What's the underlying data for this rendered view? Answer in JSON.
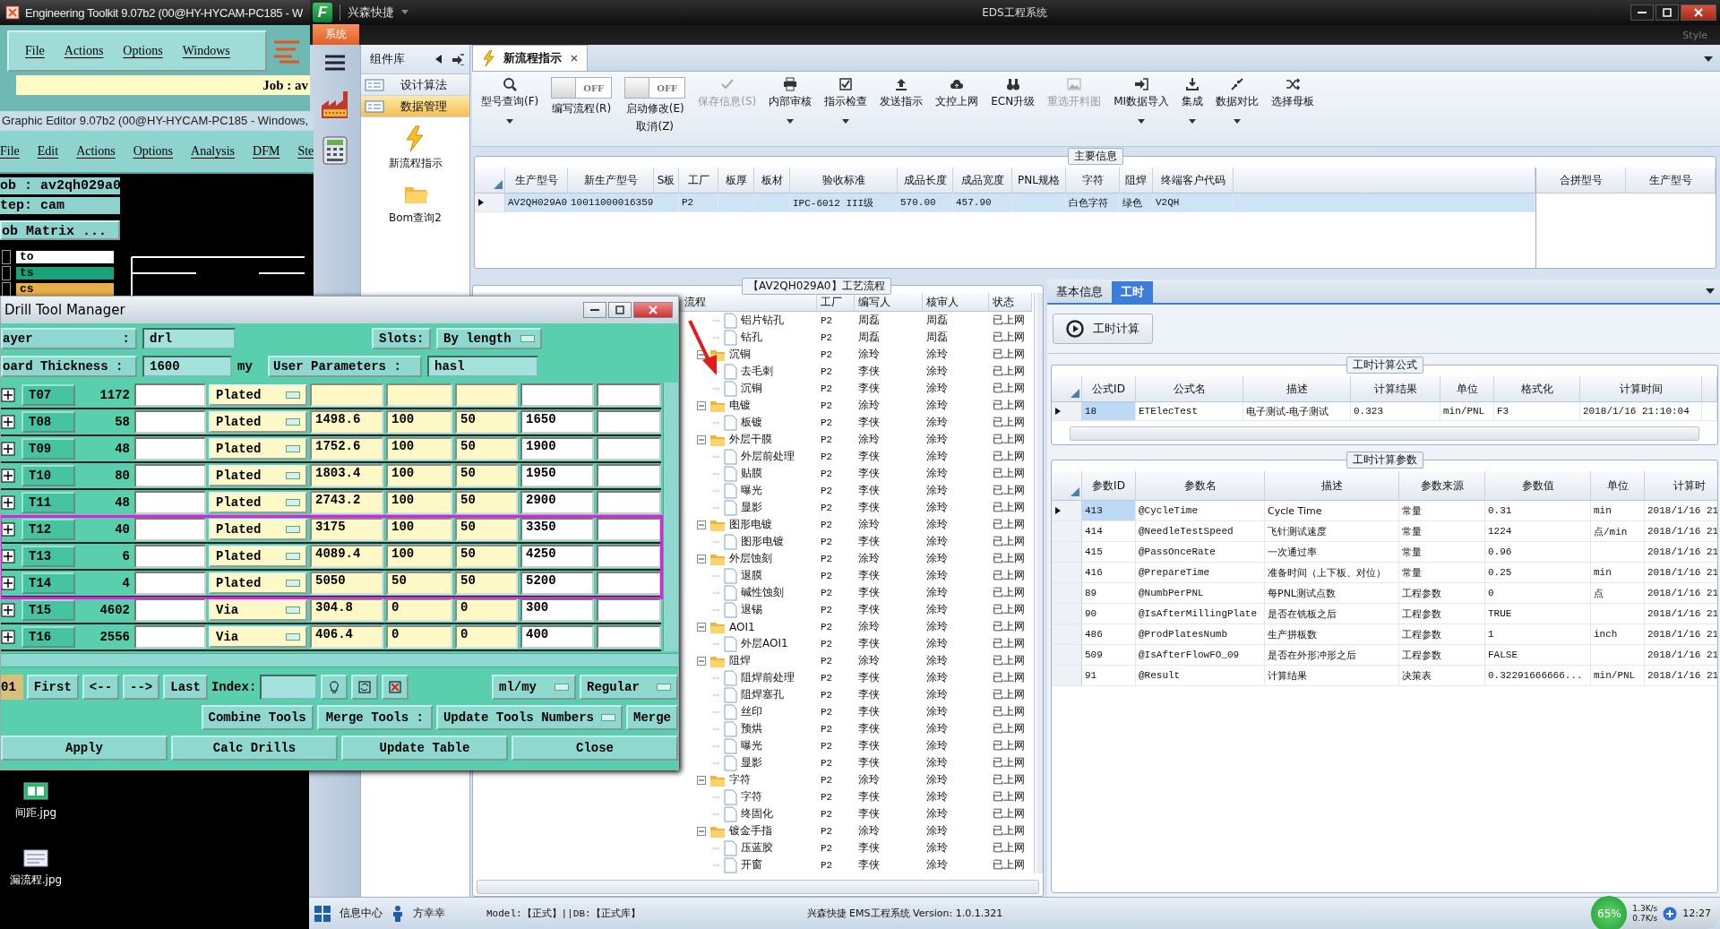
{
  "toolkit_window": {
    "title": "Engineering Toolkit 9.07b2 (00@HY-HYCAM-PC185 - W",
    "menu": [
      "File",
      "Actions",
      "Options",
      "Windows"
    ],
    "job": "Job : av"
  },
  "graphic_editor": {
    "title": "Graphic Editor 9.07b2 (00@HY-HYCAM-PC185 - Windows,",
    "menu": [
      "File",
      "Edit",
      "Actions",
      "Options",
      "Analysis",
      "DFM",
      "Ste"
    ],
    "job": "ob : av2qh029a0",
    "step": "tep: cam",
    "matrix_button": "ob Matrix ...",
    "layers": [
      {
        "name": "to",
        "color": "#ffffff",
        "checked": false
      },
      {
        "name": "ts",
        "color": "#1aa37a",
        "checked": false
      },
      {
        "name": "cs",
        "color": "#e8b04a",
        "checked": false
      }
    ]
  },
  "drill": {
    "title": "Drill Tool Manager",
    "layer_label": "ayer",
    "layer_sep": ":",
    "layer": "drl",
    "slots_label": "Slots:",
    "slots": "By length",
    "thickness_label": "oard Thickness :",
    "thickness": "1600",
    "thickness_unit": "my",
    "user_params_label": "User Parameters :",
    "user_params": "hasl",
    "rows": [
      {
        "tool": "T07",
        "count": "1172",
        "type": "Plated",
        "marked": false
      },
      {
        "tool": "T08",
        "count": "58",
        "type": "Plated",
        "value_1": "1498.6",
        "value_2": "100",
        "value_3": "50",
        "value_4": "1650",
        "marked": false
      },
      {
        "tool": "T09",
        "count": "48",
        "type": "Plated",
        "value_1": "1752.6",
        "value_2": "100",
        "value_3": "50",
        "value_4": "1900",
        "marked": false
      },
      {
        "tool": "T10",
        "count": "80",
        "type": "Plated",
        "value_1": "1803.4",
        "value_2": "100",
        "value_3": "50",
        "value_4": "1950",
        "marked": false
      },
      {
        "tool": "T11",
        "count": "48",
        "type": "Plated",
        "value_1": "2743.2",
        "value_2": "100",
        "value_3": "50",
        "value_4": "2900",
        "marked": false
      },
      {
        "tool": "T12",
        "count": "40",
        "type": "Plated",
        "value_1": "3175",
        "value_2": "100",
        "value_3": "50",
        "value_4": "3350",
        "marked": true
      },
      {
        "tool": "T13",
        "count": "6",
        "type": "Plated",
        "value_1": "4089.4",
        "value_2": "100",
        "value_3": "50",
        "value_4": "4250",
        "marked": true
      },
      {
        "tool": "T14",
        "count": "4",
        "type": "Plated",
        "value_1": "5050",
        "value_2": "50",
        "value_3": "50",
        "value_4": "5200",
        "marked": true
      },
      {
        "tool": "T15",
        "count": "4602",
        "type": "Via",
        "value_1": "304.8",
        "value_2": "0",
        "value_3": "0",
        "value_4": "300",
        "marked": false
      },
      {
        "tool": "T16",
        "count": "2556",
        "type": "Via",
        "value_1": "406.4",
        "value_2": "0",
        "value_3": "0",
        "value_4": "400",
        "marked": false
      }
    ],
    "current": "01",
    "nav": [
      "First",
      "<--",
      "-->",
      "Last"
    ],
    "index_label": "Index:",
    "units": "ml/my",
    "mode": "Regular",
    "combine": "Combine Tools",
    "merge_label": "Merge Tools :",
    "merge_option": "Update Tools Numbers",
    "merge": "Merge",
    "actions": [
      "Apply",
      "Calc Drills",
      "Update Table",
      "Close"
    ]
  },
  "eds": {
    "logo": "F",
    "app_name": "兴森快捷",
    "title": "EDS工程系统",
    "system_tab": "系统",
    "style_label": "Style",
    "component_panel": {
      "title": "组件库",
      "items": [
        {
          "label": "设计算法",
          "selected": false
        },
        {
          "label": "数据管理",
          "selected": true
        }
      ],
      "tiles": [
        {
          "label": "新流程指示"
        },
        {
          "label": "Bom查询2"
        }
      ]
    },
    "doc_tab": {
      "label": "新流程指示"
    },
    "toolbar": [
      {
        "kind": "button",
        "label": "型号查询(F)",
        "dropdown": true,
        "disabled": false
      },
      {
        "kind": "toggle",
        "label": "编写流程(R)",
        "switch_text": "OFF",
        "on": false
      },
      {
        "kind": "toggle",
        "label": "启动修改(E)",
        "second_line": "取消(Z)",
        "switch_text": "OFF",
        "on": false
      },
      {
        "kind": "button",
        "label": "保存信息(S)",
        "dropdown": false,
        "disabled": true
      },
      {
        "kind": "button",
        "label": "内部审核",
        "dropdown": true,
        "disabled": false
      },
      {
        "kind": "button",
        "label": "指示检查",
        "dropdown": true,
        "disabled": false
      },
      {
        "kind": "button",
        "label": "发送指示",
        "dropdown": false,
        "disabled": false
      },
      {
        "kind": "button",
        "label": "文控上网",
        "dropdown": false,
        "disabled": false
      },
      {
        "kind": "button",
        "label": "ECN升级",
        "dropdown": false,
        "disabled": false
      },
      {
        "kind": "button",
        "label": "重选开料图",
        "dropdown": false,
        "disabled": true
      },
      {
        "kind": "button",
        "label": "MI数据导入",
        "dropdown": true,
        "disabled": false
      },
      {
        "kind": "button",
        "label": "集成",
        "dropdown": true,
        "disabled": false
      },
      {
        "kind": "button",
        "label": "数据对比",
        "dropdown": true,
        "disabled": false
      },
      {
        "kind": "button",
        "label": "选择母板",
        "dropdown": false,
        "disabled": false
      }
    ],
    "main_info": {
      "title": "主要信息",
      "row_selected": true,
      "columns": [
        {
          "header": "生产型号",
          "cell": "AV2QH029A0"
        },
        {
          "header": "新生产型号",
          "cell": "10011000016359"
        },
        {
          "header": "S板"
        },
        {
          "header": "工厂",
          "cell": "P2"
        },
        {
          "header": "板厚"
        },
        {
          "header": "板材"
        },
        {
          "header": "验收标准",
          "cell": "IPC-6012 III级"
        },
        {
          "header": "成品长度",
          "cell": "570.00"
        },
        {
          "header": "成品宽度",
          "cell": "457.90"
        },
        {
          "header": "PNL规格"
        },
        {
          "header": "字符",
          "cell": "白色字符"
        },
        {
          "header": "阻焊",
          "cell": "绿色"
        },
        {
          "header": "终端客户代码",
          "cell": "V2QH"
        }
      ],
      "side_columns": [
        "合拼型号",
        "生产型号"
      ]
    },
    "process": {
      "title": "【AV2QH029A0】工艺流程",
      "columns": [
        "流程",
        "工厂",
        "编写人",
        "核审人",
        "状态"
      ],
      "steps": [
        {
          "kind": "step",
          "name": "铝片钻孔",
          "factory": "P2",
          "writer": "周磊",
          "reviewer": "周磊",
          "status": "已上网"
        },
        {
          "kind": "step",
          "name": "钻孔",
          "factory": "P2",
          "writer": "周磊",
          "reviewer": "周磊",
          "status": "已上网"
        },
        {
          "kind": "group",
          "name": "沉铜",
          "factory": "P2",
          "writer": "涂玲",
          "reviewer": "涂玲",
          "status": "已上网",
          "expanded": true,
          "children": [
            {
              "kind": "step",
              "name": "去毛刺",
              "factory": "P2",
              "writer": "李侠",
              "reviewer": "涂玲",
              "status": "已上网"
            },
            {
              "kind": "step",
              "name": "沉铜",
              "factory": "P2",
              "writer": "李侠",
              "reviewer": "涂玲",
              "status": "已上网"
            }
          ]
        },
        {
          "kind": "group",
          "name": "电镀",
          "factory": "P2",
          "writer": "涂玲",
          "reviewer": "涂玲",
          "status": "已上网",
          "expanded": true,
          "children": [
            {
              "kind": "step",
              "name": "板镀",
              "factory": "P2",
              "writer": "李侠",
              "reviewer": "涂玲",
              "status": "已上网"
            }
          ]
        },
        {
          "kind": "group",
          "name": "外层干膜",
          "factory": "P2",
          "writer": "涂玲",
          "reviewer": "涂玲",
          "status": "已上网",
          "expanded": true,
          "children": [
            {
              "kind": "step",
              "name": "外层前处理",
              "factory": "P2",
              "writer": "李侠",
              "reviewer": "涂玲",
              "status": "已上网"
            },
            {
              "kind": "step",
              "name": "贴膜",
              "factory": "P2",
              "writer": "李侠",
              "reviewer": "涂玲",
              "status": "已上网"
            },
            {
              "kind": "step",
              "name": "曝光",
              "factory": "P2",
              "writer": "李侠",
              "reviewer": "涂玲",
              "status": "已上网"
            },
            {
              "kind": "step",
              "name": "显影",
              "factory": "P2",
              "writer": "李侠",
              "reviewer": "涂玲",
              "status": "已上网"
            }
          ]
        },
        {
          "kind": "group",
          "name": "图形电镀",
          "factory": "P2",
          "writer": "涂玲",
          "reviewer": "涂玲",
          "status": "已上网",
          "expanded": true,
          "children": [
            {
              "kind": "step",
              "name": "图形电镀",
              "factory": "P2",
              "writer": "李侠",
              "reviewer": "涂玲",
              "status": "已上网"
            }
          ]
        },
        {
          "kind": "group",
          "name": "外层蚀刻",
          "factory": "P2",
          "writer": "涂玲",
          "reviewer": "涂玲",
          "status": "已上网",
          "expanded": true,
          "children": [
            {
              "kind": "step",
              "name": "退膜",
              "factory": "P2",
              "writer": "李侠",
              "reviewer": "涂玲",
              "status": "已上网"
            },
            {
              "kind": "step",
              "name": "碱性蚀刻",
              "factory": "P2",
              "writer": "李侠",
              "reviewer": "涂玲",
              "status": "已上网"
            },
            {
              "kind": "step",
              "name": "退锡",
              "factory": "P2",
              "writer": "李侠",
              "reviewer": "涂玲",
              "status": "已上网"
            }
          ]
        },
        {
          "kind": "group",
          "name": "AOI1",
          "factory": "P2",
          "writer": "涂玲",
          "reviewer": "涂玲",
          "status": "已上网",
          "expanded": true,
          "children": [
            {
              "kind": "step",
              "name": "外层AOI1",
              "factory": "P2",
              "writer": "李侠",
              "reviewer": "涂玲",
              "status": "已上网"
            }
          ]
        },
        {
          "kind": "group",
          "name": "阻焊",
          "factory": "P2",
          "writer": "涂玲",
          "reviewer": "涂玲",
          "status": "已上网",
          "expanded": true,
          "children": [
            {
              "kind": "step",
              "name": "阻焊前处理",
              "factory": "P2",
              "writer": "李侠",
              "reviewer": "涂玲",
              "status": "已上网"
            },
            {
              "kind": "step",
              "name": "阻焊塞孔",
              "factory": "P2",
              "writer": "李侠",
              "reviewer": "涂玲",
              "status": "已上网"
            },
            {
              "kind": "step",
              "name": "丝印",
              "factory": "P2",
              "writer": "李侠",
              "reviewer": "涂玲",
              "status": "已上网"
            },
            {
              "kind": "step",
              "name": "预烘",
              "factory": "P2",
              "writer": "李侠",
              "reviewer": "涂玲",
              "status": "已上网"
            },
            {
              "kind": "step",
              "name": "曝光",
              "factory": "P2",
              "writer": "李侠",
              "reviewer": "涂玲",
              "status": "已上网"
            },
            {
              "kind": "step",
              "name": "显影",
              "factory": "P2",
              "writer": "李侠",
              "reviewer": "涂玲",
              "status": "已上网"
            }
          ]
        },
        {
          "kind": "group",
          "name": "字符",
          "factory": "P2",
          "writer": "涂玲",
          "reviewer": "涂玲",
          "status": "已上网",
          "expanded": true,
          "children": [
            {
              "kind": "step",
              "name": "字符",
              "factory": "P2",
              "writer": "李侠",
              "reviewer": "涂玲",
              "status": "已上网"
            },
            {
              "kind": "step",
              "name": "终固化",
              "factory": "P2",
              "writer": "李侠",
              "reviewer": "涂玲",
              "status": "已上网"
            }
          ]
        },
        {
          "kind": "group",
          "name": "镀金手指",
          "factory": "P2",
          "writer": "涂玲",
          "reviewer": "涂玲",
          "status": "已上网",
          "expanded": true,
          "children": [
            {
              "kind": "step",
              "name": "压蓝胶",
              "factory": "P2",
              "writer": "李侠",
              "reviewer": "涂玲",
              "status": "已上网"
            },
            {
              "kind": "step",
              "name": "开窗",
              "factory": "P2",
              "writer": "李侠",
              "reviewer": "涂玲",
              "status": "已上网"
            }
          ]
        }
      ]
    },
    "detail": {
      "tabs": [
        {
          "label": "基本信息",
          "selected": false
        },
        {
          "label": "工时",
          "selected": true
        }
      ],
      "calc_button": "工时计算",
      "formula": {
        "title": "工时计算公式",
        "row_selected": true,
        "columns": [
          {
            "header": "公式ID",
            "cell": "18"
          },
          {
            "header": "公式名",
            "cell": "ETElecTest"
          },
          {
            "header": "描述",
            "cell": "电子测试-电子测试"
          },
          {
            "header": "计算结果",
            "cell": "0.323"
          },
          {
            "header": "单位",
            "cell": "min/PNL"
          },
          {
            "header": "格式化",
            "cell": "F3"
          },
          {
            "header": "计算时间",
            "cell": "2018/1/16 21:10:04"
          }
        ]
      },
      "params": {
        "title": "工时计算参数",
        "columns": [
          "参数ID",
          "参数名",
          "描述",
          "参数来源",
          "参数值",
          "单位",
          "计算时"
        ],
        "rows": [
          {
            "id": "413",
            "name": "@CycleTime",
            "description": "Cycle Time",
            "source": "常量",
            "value": "0.31",
            "unit": "min",
            "time": "2018/1/16 21",
            "selected": true
          },
          {
            "id": "414",
            "name": "@NeedleTestSpeed",
            "description": "飞针测试速度",
            "source": "常量",
            "value": "1224",
            "unit": "点/min",
            "time": "2018/1/16 21",
            "selected": false
          },
          {
            "id": "415",
            "name": "@PassOnceRate",
            "description": "一次通过率",
            "source": "常量",
            "value": "0.96",
            "time": "2018/1/16 21",
            "selected": false
          },
          {
            "id": "416",
            "name": "@PrepareTime",
            "description": "准备时间（上下板、对位）",
            "source": "常量",
            "value": "0.25",
            "unit": "min",
            "time": "2018/1/16 21",
            "selected": false
          },
          {
            "id": "89",
            "name": "@NumbPerPNL",
            "description": "每PNL测试点数",
            "source": "工程参数",
            "value": "0",
            "unit": "点",
            "time": "2018/1/16 21",
            "selected": false
          },
          {
            "id": "90",
            "name": "@IsAfterMillingPlate",
            "description": "是否在铣板之后",
            "source": "工程参数",
            "value": "TRUE",
            "time": "2018/1/16 21",
            "selected": false
          },
          {
            "id": "486",
            "name": "@ProdPlatesNumb",
            "description": "生产拼板数",
            "source": "工程参数",
            "value": "1",
            "unit": "inch",
            "time": "2018/1/16 21",
            "selected": false
          },
          {
            "id": "509",
            "name": "@IsAfterFlowFO_09",
            "description": "是否在外形冲形之后",
            "source": "工程参数",
            "value": "FALSE",
            "time": "2018/1/16 21",
            "selected": false
          },
          {
            "id": "91",
            "name": "@Result",
            "description": "计算结果",
            "source": "决策表",
            "value": "0.32291666666...",
            "unit": "min/PNL",
            "time": "2018/1/16 21",
            "selected": false
          }
        ]
      }
    },
    "status_bar": {
      "info_center": "信息中心",
      "user": "方幸幸",
      "model": "Model:【正式】||DB:【正式库】",
      "version": "兴森快捷 EMS工程系统 Version: 1.0.1.321",
      "cpu": "65%",
      "upload": "1.3K/s",
      "download": "0.7K/s",
      "time": "12:27"
    }
  },
  "desktop_icons": [
    {
      "label": "间距.jpg"
    },
    {
      "label": "漏流程.jpg"
    }
  ]
}
